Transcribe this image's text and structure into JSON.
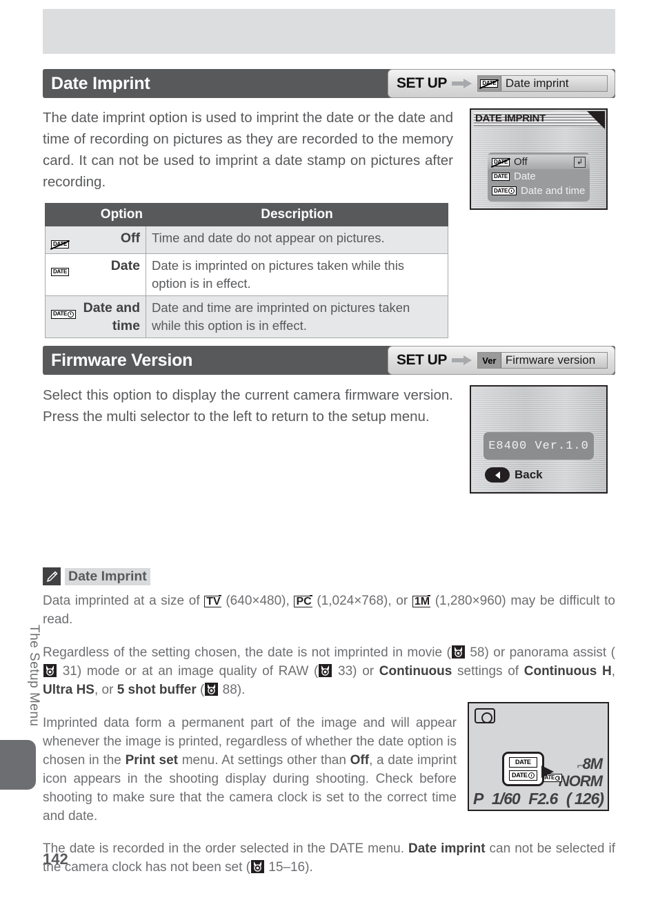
{
  "page": {
    "number": "142",
    "side_label": "The Setup Menu"
  },
  "sections": [
    {
      "title": "Date Imprint",
      "badge": {
        "menu": "SET UP",
        "arrow": "arrow-right-icon",
        "icon": "date-off-icon",
        "item": "Date imprint"
      },
      "body": "The date imprint option is used to imprint the date or the date and time of recording on pictures as they are recorded to the memory card.  It can not be used to imprint a date stamp on pictures after recording.",
      "lcd": {
        "title": "DATE IMPRINT",
        "items": [
          {
            "icon": "date-off-icon",
            "label": "Off",
            "selected": true,
            "enter": "↲"
          },
          {
            "icon": "date-icon",
            "label": "Date",
            "selected": false
          },
          {
            "icon": "date-time-icon",
            "label": "Date and time",
            "selected": false
          }
        ]
      },
      "table": {
        "headers": [
          "Option",
          "Description"
        ],
        "rows": [
          {
            "icon": "date-off-icon",
            "option": "Off",
            "description": "Time and date do not appear on pictures."
          },
          {
            "icon": "date-icon",
            "option": "Date",
            "description": "Date is imprinted on pictures taken while this option is in effect."
          },
          {
            "icon": "date-time-icon",
            "option": "Date and time",
            "description": "Date and time are imprinted on pictures taken while this option is in effect."
          }
        ]
      }
    },
    {
      "title": "Firmware Version",
      "badge": {
        "menu": "SET UP",
        "arrow": "arrow-right-icon",
        "icon": "Ver",
        "item": "Firmware version"
      },
      "body": "Select this option to display the current camera firmware version.  Press the multi selector to the left to return to the setup menu.",
      "lcd": {
        "version": "E8400 Ver.1.0",
        "back_label": "Back"
      }
    }
  ],
  "note": {
    "icon": "pencil-icon",
    "title": "Date Imprint",
    "paragraphs": [
      {
        "id": "p1",
        "parts": [
          {
            "t": "text",
            "v": "Data imprinted at a size of "
          },
          {
            "t": "boxico",
            "v": "TV"
          },
          {
            "t": "text",
            "v": " (640×480), "
          },
          {
            "t": "boxico",
            "v": "PC"
          },
          {
            "t": "text",
            "v": " (1,024×768), or "
          },
          {
            "t": "boxico",
            "v": "1M"
          },
          {
            "t": "text",
            "v": " (1,280×960) may be difficult to read."
          }
        ]
      },
      {
        "id": "p2",
        "parts": [
          {
            "t": "text",
            "v": "Regardless of the setting chosen, the date is not imprinted in movie ("
          },
          {
            "t": "ref",
            "v": "58"
          },
          {
            "t": "text",
            "v": ") or panorama assist ("
          },
          {
            "t": "ref",
            "v": "31"
          },
          {
            "t": "text",
            "v": ") mode or at an image quality of RAW ("
          },
          {
            "t": "ref",
            "v": "33"
          },
          {
            "t": "text",
            "v": ") or "
          },
          {
            "t": "bold",
            "v": "Continuous"
          },
          {
            "t": "text",
            "v": " settings of "
          },
          {
            "t": "bold",
            "v": "Continuous H"
          },
          {
            "t": "text",
            "v": ", "
          },
          {
            "t": "bold",
            "v": "Ultra HS"
          },
          {
            "t": "text",
            "v": ", or "
          },
          {
            "t": "bold",
            "v": "5 shot buffer"
          },
          {
            "t": "text",
            "v": " ("
          },
          {
            "t": "ref",
            "v": "88"
          },
          {
            "t": "text",
            "v": ")."
          }
        ]
      },
      {
        "id": "p3",
        "parts": [
          {
            "t": "text",
            "v": "Imprinted data form a permanent part of the image and will appear whenever the image is printed, regardless of whether the date option is chosen in the "
          },
          {
            "t": "bold",
            "v": "Print set"
          },
          {
            "t": "text",
            "v": " menu.  At settings other than "
          },
          {
            "t": "bold",
            "v": "Off"
          },
          {
            "t": "text",
            "v": ", a date imprint icon appears in the shooting display during shooting.  Check before shooting to make sure that the camera clock is set to the correct time and date."
          }
        ]
      },
      {
        "id": "p4",
        "parts": [
          {
            "t": "text",
            "v": "The date is recorded in the order selected in the DATE menu.  "
          },
          {
            "t": "bold",
            "v": "Date imprint"
          },
          {
            "t": "text",
            "v": " can not be selected if the camera clock has not been set ("
          },
          {
            "t": "ref",
            "v": "15–16"
          },
          {
            "t": "text",
            "v": ")."
          }
        ]
      }
    ],
    "shooting_display": {
      "camera_icon": "camera-icon",
      "mode": "P",
      "shutter": "1/60",
      "aperture": "F2.6",
      "frames": "( 126)",
      "image_size": "8M",
      "quality": "NORM",
      "callout_icons": [
        "date-icon",
        "date-time-icon"
      ],
      "indicator_icon": "date-time-icon"
    }
  },
  "colors": {
    "header_bar": "#58595b",
    "body_text": "#58595b",
    "note_text": "#6d6e71",
    "table_header": "#58595b",
    "top_band": "#dcdddf"
  }
}
